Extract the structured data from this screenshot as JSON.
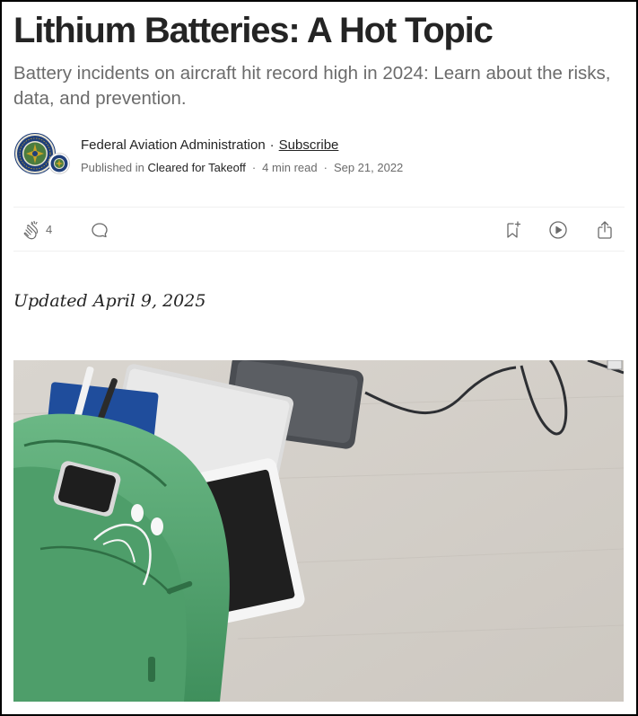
{
  "article": {
    "title": "Lithium Batteries: A Hot Topic",
    "subtitle": "Battery incidents on aircraft hit record high in 2024: Learn about the risks, data, and prevention.",
    "updated": "Updated April 9, 2025"
  },
  "author": {
    "name": "Federal Aviation Administration",
    "separator": "·",
    "subscribe_label": "Subscribe"
  },
  "meta": {
    "published_in_label": "Published in",
    "publication": "Cleared for Takeoff",
    "read_time": "4 min read",
    "date": "Sep 21, 2022",
    "separator": "·"
  },
  "actions": {
    "clap_count": "4",
    "icons": [
      "clap-icon",
      "comment-icon",
      "bookmark-add-icon",
      "play-icon",
      "share-icon"
    ]
  },
  "colors": {
    "text": "#242424",
    "muted": "#6b6b6b",
    "divider": "#f0f0f0",
    "seal_blue": "#1f3f7a",
    "seal_gold": "#c9a227",
    "bag_green": "#5fae78"
  }
}
